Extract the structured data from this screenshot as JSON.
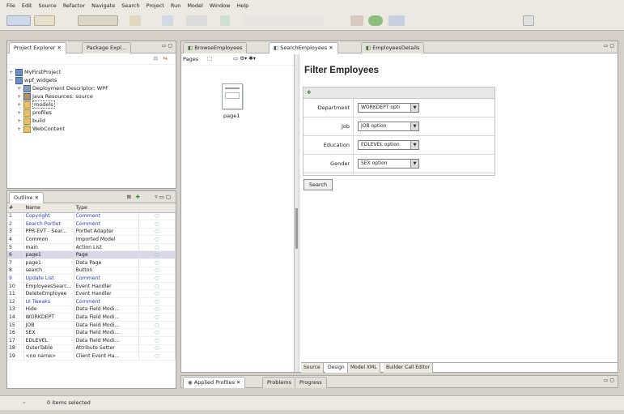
{
  "menu": [
    "File",
    "Edit",
    "Source",
    "Refactor",
    "Navigate",
    "Search",
    "Project",
    "Run",
    "Model",
    "Window",
    "Help"
  ],
  "left_tabs": {
    "project_explorer": "Project Explorer",
    "package_explorer": "Package Expl..."
  },
  "project_tree": [
    {
      "label": "MyFirstProject"
    },
    {
      "label": "wpf_widgets"
    },
    {
      "label": "Deployment Descriptor: WPF"
    },
    {
      "label": "Java Resources: source"
    },
    {
      "label": "models"
    },
    {
      "label": "profiles"
    },
    {
      "label": "build"
    },
    {
      "label": "WebContent"
    }
  ],
  "outline": {
    "tab": "Outline",
    "columns": [
      "#",
      "Name",
      "Type"
    ],
    "rows": [
      {
        "n": "1",
        "name": "Copyright",
        "type": "Comment"
      },
      {
        "n": "2",
        "name": "Search Portlet",
        "type": "Comment"
      },
      {
        "n": "3",
        "name": "PPR-EVT - Sear...",
        "type": "Portlet Adapter"
      },
      {
        "n": "4",
        "name": "Common",
        "type": "Imported Model"
      },
      {
        "n": "5",
        "name": "main",
        "type": "Action List"
      },
      {
        "n": "6",
        "name": "page1",
        "type": "Page"
      },
      {
        "n": "7",
        "name": "page1",
        "type": "Data Page"
      },
      {
        "n": "8",
        "name": "search",
        "type": "Button"
      },
      {
        "n": "9",
        "name": "Update List",
        "type": "Comment"
      },
      {
        "n": "10",
        "name": "EmployeesSearc...",
        "type": "Event Handler"
      },
      {
        "n": "11",
        "name": "DeleteEmployee",
        "type": "Event Handler"
      },
      {
        "n": "12",
        "name": "UI Tweaks",
        "type": "Comment"
      },
      {
        "n": "13",
        "name": "Hide",
        "type": "Data Field Modi..."
      },
      {
        "n": "14",
        "name": "WORKDEPT",
        "type": "Data Field Modi..."
      },
      {
        "n": "15",
        "name": "JOB",
        "type": "Data Field Modi..."
      },
      {
        "n": "16",
        "name": "SEX",
        "type": "Data Field Modi..."
      },
      {
        "n": "17",
        "name": "EDLEVEL",
        "type": "Data Field Modi..."
      },
      {
        "n": "18",
        "name": "OuterTable",
        "type": "Attribute Setter"
      },
      {
        "n": "19",
        "name": "<no name>",
        "type": "Client Event Ha..."
      }
    ]
  },
  "editor_tabs": [
    "BrowseEmployees",
    "SearchEmployees",
    "EmployeesDetails"
  ],
  "pages_label": "Pages",
  "page_item": "page1",
  "form": {
    "title": "Filter Employees",
    "fields": [
      {
        "label": "Department",
        "value": "WORKDEPT opti"
      },
      {
        "label": "Job",
        "value": "JOB option"
      },
      {
        "label": "Education",
        "value": "EDLEVEL option"
      },
      {
        "label": "Gender",
        "value": "SEX option"
      }
    ],
    "button": "Search"
  },
  "editor_bottom_tabs": [
    "Source",
    "Design",
    "Model XML",
    "Builder Call Editor"
  ],
  "bottom_tabs": [
    "Applied Profiles",
    "Problems",
    "Progress"
  ],
  "status": "0 items selected"
}
